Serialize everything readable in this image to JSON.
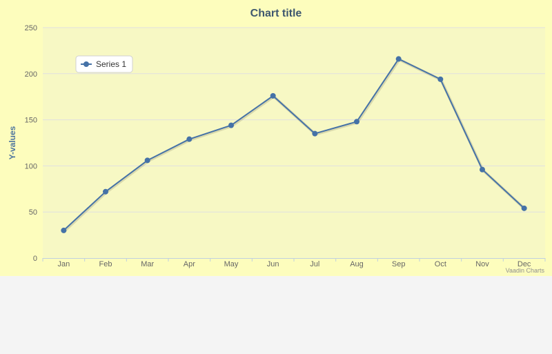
{
  "chart_data": {
    "type": "line",
    "title": "Chart title",
    "xlabel": "",
    "ylabel": "Y-values",
    "categories": [
      "Jan",
      "Feb",
      "Mar",
      "Apr",
      "May",
      "Jun",
      "Jul",
      "Aug",
      "Sep",
      "Oct",
      "Nov",
      "Dec"
    ],
    "series": [
      {
        "name": "Series 1",
        "values": [
          30,
          72,
          106,
          129,
          144,
          176,
          135,
          148,
          216,
          194,
          96,
          54
        ]
      }
    ],
    "ylim": [
      0,
      250
    ],
    "yticks": [
      0,
      50,
      100,
      150,
      200,
      250
    ],
    "grid": "horizontal",
    "legend": "top-left inside plot",
    "credits": "Vaadin Charts",
    "colors": {
      "page_background": "#fdfdbd",
      "plot_background": "#f7f8c4",
      "series": "#4572a7",
      "gridline": "#e0e0e0",
      "axis_line": "#c0d0e0",
      "title": "#3e576f"
    }
  }
}
